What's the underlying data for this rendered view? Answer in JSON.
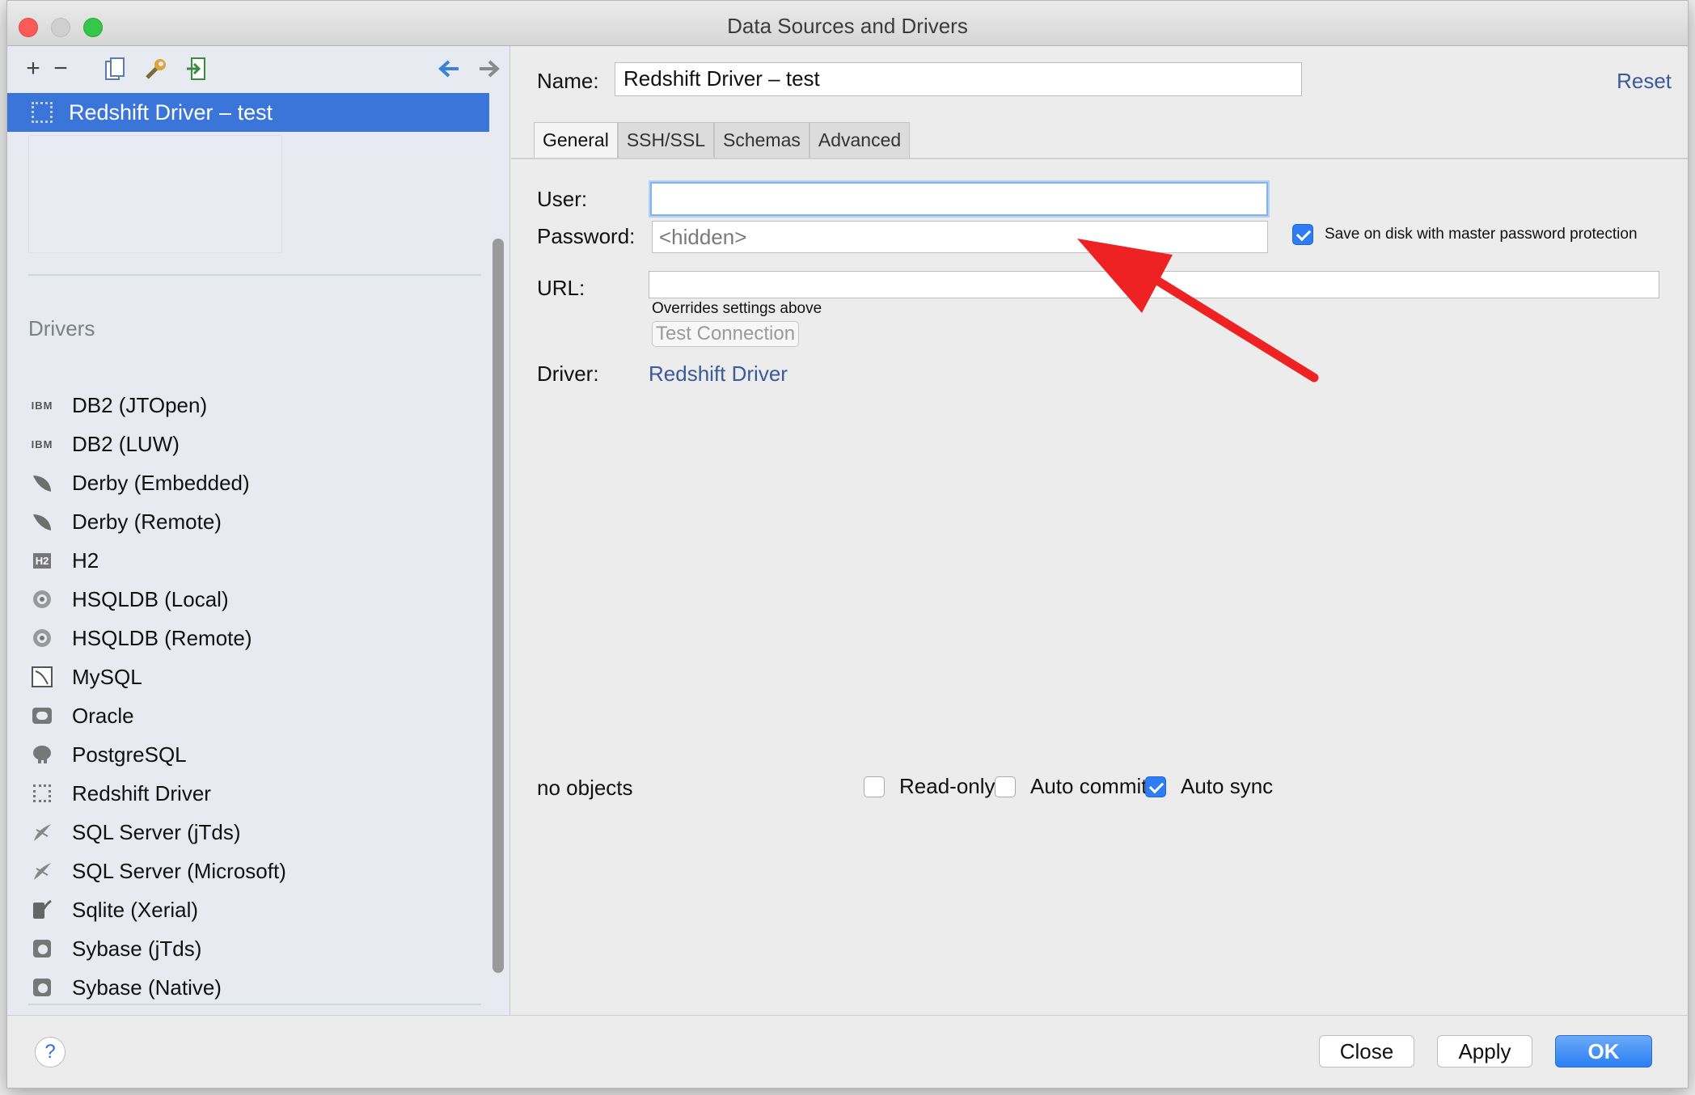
{
  "window": {
    "title": "Data Sources and Drivers"
  },
  "left": {
    "toolbar": {
      "icons": [
        "add-icon",
        "remove-icon",
        "copy-icon",
        "wrench-icon",
        "import-icon",
        "back-arrow-icon",
        "forward-arrow-icon"
      ],
      "add_glyph": "+",
      "remove_glyph": "−"
    },
    "selected_item": {
      "label": "Redshift Driver – test"
    },
    "drivers_heading": "Drivers",
    "drivers": [
      {
        "label": "DB2 (JTOpen)",
        "icon": "ibm-icon"
      },
      {
        "label": "DB2 (LUW)",
        "icon": "ibm-icon"
      },
      {
        "label": "Derby (Embedded)",
        "icon": "derby-feather-icon"
      },
      {
        "label": "Derby (Remote)",
        "icon": "derby-feather-icon"
      },
      {
        "label": "H2",
        "icon": "h2-icon"
      },
      {
        "label": "HSQLDB (Local)",
        "icon": "hsqldb-icon"
      },
      {
        "label": "HSQLDB (Remote)",
        "icon": "hsqldb-icon"
      },
      {
        "label": "MySQL",
        "icon": "mysql-icon"
      },
      {
        "label": "Oracle",
        "icon": "oracle-icon"
      },
      {
        "label": "PostgreSQL",
        "icon": "postgresql-elephant-icon"
      },
      {
        "label": "Redshift Driver",
        "icon": "redshift-icon"
      },
      {
        "label": "SQL Server (jTds)",
        "icon": "sqlserver-icon"
      },
      {
        "label": "SQL Server (Microsoft)",
        "icon": "sqlserver-icon"
      },
      {
        "label": "Sqlite (Xerial)",
        "icon": "sqlite-feather-icon"
      },
      {
        "label": "Sybase (jTds)",
        "icon": "sybase-icon"
      },
      {
        "label": "Sybase (Native)",
        "icon": "sybase-icon"
      }
    ]
  },
  "main": {
    "name_label": "Name:",
    "name_value": "Redshift Driver – test",
    "reset_label": "Reset",
    "tabs": [
      {
        "label": "General",
        "active": true
      },
      {
        "label": "SSH/SSL",
        "active": false
      },
      {
        "label": "Schemas",
        "active": false
      },
      {
        "label": "Advanced",
        "active": false
      }
    ],
    "user_label": "User:",
    "user_value": "",
    "password_label": "Password:",
    "password_placeholder": "<hidden>",
    "save_on_disk_label": "Save on disk with master password protection",
    "save_on_disk_checked": true,
    "url_label": "URL:",
    "url_value": "",
    "url_hint": "Overrides settings above",
    "test_connection_label": "Test Connection",
    "driver_label": "Driver:",
    "driver_link": "Redshift Driver",
    "status_text": "no objects",
    "options": [
      {
        "label": "Read-only",
        "checked": false
      },
      {
        "label": "Auto commit",
        "checked": false
      },
      {
        "label": "Auto sync",
        "checked": true
      }
    ]
  },
  "footer": {
    "help_label": "?",
    "close_label": "Close",
    "apply_label": "Apply",
    "ok_label": "OK"
  },
  "colors": {
    "selection": "#3b75d9",
    "link": "#3a5a9a",
    "annotation_arrow": "#ee2222",
    "primary_button": "#2b7ef3"
  }
}
